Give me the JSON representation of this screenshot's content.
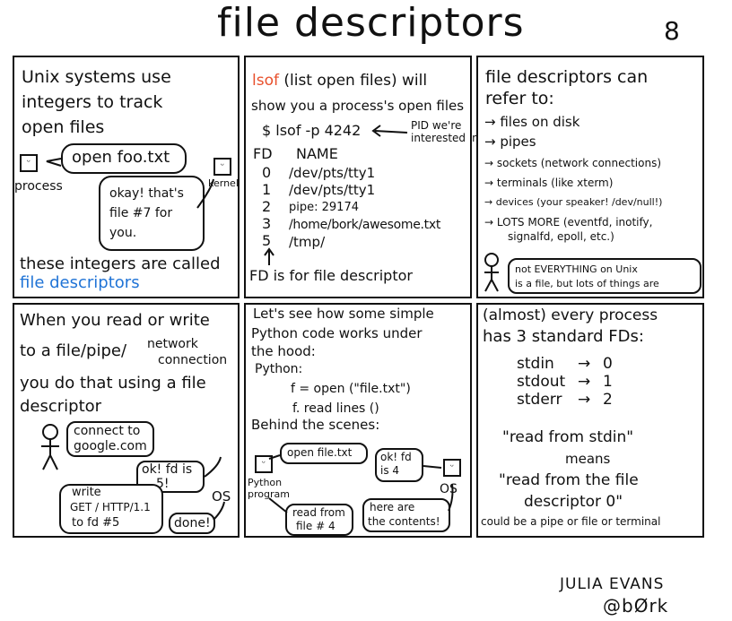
{
  "title": "file descriptors",
  "page_number": "8",
  "panel1": {
    "intro": [
      "Unix systems use",
      "integers to track",
      "open files"
    ],
    "process_label": "process",
    "kernel_label": "kernel",
    "process_says": "open foo.txt",
    "kernel_says": [
      "okay! that's",
      "file #7 for",
      "you."
    ],
    "footer_1": "these integers are called",
    "footer_2": "file descriptors"
  },
  "panel2": {
    "intro_1_lsof": "lsof",
    "intro_1_rest": "(list open files) will",
    "intro_2": "show you a process's open files",
    "command": "$ lsof -p 4242",
    "pid_note": [
      "PID we're",
      "interested in"
    ],
    "col_fd": "FD",
    "col_name": "NAME",
    "rows": [
      {
        "fd": "0",
        "name": "/dev/pts/tty1"
      },
      {
        "fd": "1",
        "name": "/dev/pts/tty1"
      },
      {
        "fd": "2",
        "name": "pipe: 29174"
      },
      {
        "fd": "3",
        "name": "/home/bork/awesome.txt"
      },
      {
        "fd": "5",
        "name": "/tmp/"
      }
    ],
    "footer": "FD is for file descriptor"
  },
  "panel3": {
    "intro": [
      "file descriptors can",
      "refer to:"
    ],
    "items": [
      "→ files on disk",
      "→ pipes",
      "→ sockets (network connections)",
      "→ terminals (like xterm)",
      "→ devices (your speaker! /dev/null!)",
      "→ LOTS MORE (eventfd, inotify,",
      "signalfd, epoll, etc.)"
    ],
    "note": [
      "not EVERYTHING on Unix",
      "is a file, but lots of things are"
    ]
  },
  "panel4": {
    "intro_1": "When you read or write",
    "intro_2a": "to a file/pipe/",
    "intro_2b": [
      "network",
      "connection"
    ],
    "intro_3": "you do that using a file",
    "intro_4": "descriptor",
    "person_says": [
      "connect to",
      "google.com"
    ],
    "os_says_1": [
      "ok! fd is",
      "5!"
    ],
    "person_says_2": [
      "write",
      "GET / HTTP/1.1",
      "to fd #5"
    ],
    "os_says_2": "done!",
    "os_label": "OS"
  },
  "panel5": {
    "intro": [
      "Let's see how some simple",
      "Python code works under",
      "the hood:"
    ],
    "python_label": "Python:",
    "code_1": "f = open (\"file.txt\")",
    "code_2": "f. read lines ()",
    "behind": "Behind the scenes:",
    "program_label": [
      "Python",
      "program"
    ],
    "os_label": "OS",
    "bubble_open": "open file.txt",
    "bubble_ok": [
      "ok! fd",
      "is 4"
    ],
    "bubble_read": [
      "read from",
      "file # 4"
    ],
    "bubble_contents": [
      "here are",
      "the contents!"
    ]
  },
  "panel6": {
    "intro": [
      "(almost) every process",
      "has 3 standard FDs:"
    ],
    "fds": [
      {
        "name": "stdin",
        "num": "0"
      },
      {
        "name": "stdout",
        "num": "1"
      },
      {
        "name": "stderr",
        "num": "2"
      }
    ],
    "quote_1": "\"read from stdin\"",
    "means": "means",
    "quote_2": [
      "\"read from the file",
      "descriptor 0\""
    ],
    "footer": "could be a pipe or file or terminal"
  },
  "signature": {
    "name": "JULIA EVANS",
    "handle": "@bØrk"
  }
}
